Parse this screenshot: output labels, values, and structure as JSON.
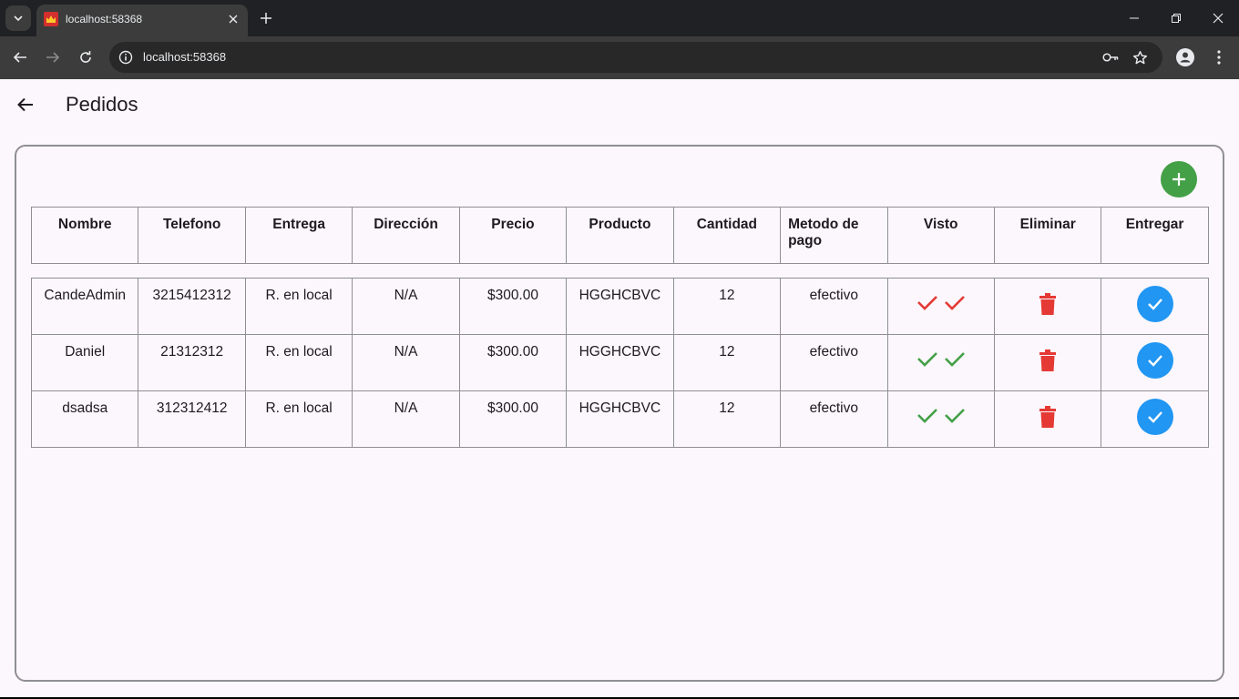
{
  "browser": {
    "tab_title": "localhost:58368",
    "url": "localhost:58368"
  },
  "appbar": {
    "title": "Pedidos"
  },
  "table": {
    "headers": [
      "Nombre",
      "Telefono",
      "Entrega",
      "Dirección",
      "Precio",
      "Producto",
      "Cantidad",
      "Metodo de pago",
      "Visto",
      "Eliminar",
      "Entregar"
    ],
    "rows": [
      {
        "nombre": "CandeAdmin",
        "telefono": "3215412312",
        "entrega": "R. en local",
        "direccion": "N/A",
        "precio": "$300.00",
        "producto": "HGGHCBVC",
        "cantidad": "12",
        "metodo": "efectivo",
        "visto_color": "#e53935"
      },
      {
        "nombre": "Daniel",
        "telefono": "21312312",
        "entrega": "R. en local",
        "direccion": "N/A",
        "precio": "$300.00",
        "producto": "HGGHCBVC",
        "cantidad": "12",
        "metodo": "efectivo",
        "visto_color": "#43a047"
      },
      {
        "nombre": "dsadsa",
        "telefono": "312312412",
        "entrega": "R. en local",
        "direccion": "N/A",
        "precio": "$300.00",
        "producto": "HGGHCBVC",
        "cantidad": "12",
        "metodo": "efectivo",
        "visto_color": "#43a047"
      }
    ]
  },
  "colors": {
    "add": "#43a047",
    "delete": "#e53935",
    "deliver": "#2196f3",
    "seen_unread": "#e53935",
    "seen_read": "#43a047"
  },
  "icons": {
    "add": "plus-icon",
    "delete": "trash-icon",
    "deliver": "check-circle-icon",
    "seen": "double-check-icon",
    "back": "arrow-left-icon"
  }
}
